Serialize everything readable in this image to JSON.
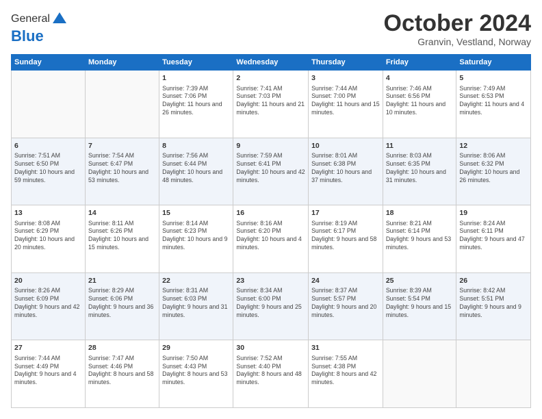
{
  "logo": {
    "general": "General",
    "blue": "Blue"
  },
  "header": {
    "month": "October 2024",
    "location": "Granvin, Vestland, Norway"
  },
  "weekdays": [
    "Sunday",
    "Monday",
    "Tuesday",
    "Wednesday",
    "Thursday",
    "Friday",
    "Saturday"
  ],
  "weeks": [
    [
      {
        "day": "",
        "info": ""
      },
      {
        "day": "",
        "info": ""
      },
      {
        "day": "1",
        "info": "Sunrise: 7:39 AM\nSunset: 7:06 PM\nDaylight: 11 hours and 26 minutes."
      },
      {
        "day": "2",
        "info": "Sunrise: 7:41 AM\nSunset: 7:03 PM\nDaylight: 11 hours and 21 minutes."
      },
      {
        "day": "3",
        "info": "Sunrise: 7:44 AM\nSunset: 7:00 PM\nDaylight: 11 hours and 15 minutes."
      },
      {
        "day": "4",
        "info": "Sunrise: 7:46 AM\nSunset: 6:56 PM\nDaylight: 11 hours and 10 minutes."
      },
      {
        "day": "5",
        "info": "Sunrise: 7:49 AM\nSunset: 6:53 PM\nDaylight: 11 hours and 4 minutes."
      }
    ],
    [
      {
        "day": "6",
        "info": "Sunrise: 7:51 AM\nSunset: 6:50 PM\nDaylight: 10 hours and 59 minutes."
      },
      {
        "day": "7",
        "info": "Sunrise: 7:54 AM\nSunset: 6:47 PM\nDaylight: 10 hours and 53 minutes."
      },
      {
        "day": "8",
        "info": "Sunrise: 7:56 AM\nSunset: 6:44 PM\nDaylight: 10 hours and 48 minutes."
      },
      {
        "day": "9",
        "info": "Sunrise: 7:59 AM\nSunset: 6:41 PM\nDaylight: 10 hours and 42 minutes."
      },
      {
        "day": "10",
        "info": "Sunrise: 8:01 AM\nSunset: 6:38 PM\nDaylight: 10 hours and 37 minutes."
      },
      {
        "day": "11",
        "info": "Sunrise: 8:03 AM\nSunset: 6:35 PM\nDaylight: 10 hours and 31 minutes."
      },
      {
        "day": "12",
        "info": "Sunrise: 8:06 AM\nSunset: 6:32 PM\nDaylight: 10 hours and 26 minutes."
      }
    ],
    [
      {
        "day": "13",
        "info": "Sunrise: 8:08 AM\nSunset: 6:29 PM\nDaylight: 10 hours and 20 minutes."
      },
      {
        "day": "14",
        "info": "Sunrise: 8:11 AM\nSunset: 6:26 PM\nDaylight: 10 hours and 15 minutes."
      },
      {
        "day": "15",
        "info": "Sunrise: 8:14 AM\nSunset: 6:23 PM\nDaylight: 10 hours and 9 minutes."
      },
      {
        "day": "16",
        "info": "Sunrise: 8:16 AM\nSunset: 6:20 PM\nDaylight: 10 hours and 4 minutes."
      },
      {
        "day": "17",
        "info": "Sunrise: 8:19 AM\nSunset: 6:17 PM\nDaylight: 9 hours and 58 minutes."
      },
      {
        "day": "18",
        "info": "Sunrise: 8:21 AM\nSunset: 6:14 PM\nDaylight: 9 hours and 53 minutes."
      },
      {
        "day": "19",
        "info": "Sunrise: 8:24 AM\nSunset: 6:11 PM\nDaylight: 9 hours and 47 minutes."
      }
    ],
    [
      {
        "day": "20",
        "info": "Sunrise: 8:26 AM\nSunset: 6:09 PM\nDaylight: 9 hours and 42 minutes."
      },
      {
        "day": "21",
        "info": "Sunrise: 8:29 AM\nSunset: 6:06 PM\nDaylight: 9 hours and 36 minutes."
      },
      {
        "day": "22",
        "info": "Sunrise: 8:31 AM\nSunset: 6:03 PM\nDaylight: 9 hours and 31 minutes."
      },
      {
        "day": "23",
        "info": "Sunrise: 8:34 AM\nSunset: 6:00 PM\nDaylight: 9 hours and 25 minutes."
      },
      {
        "day": "24",
        "info": "Sunrise: 8:37 AM\nSunset: 5:57 PM\nDaylight: 9 hours and 20 minutes."
      },
      {
        "day": "25",
        "info": "Sunrise: 8:39 AM\nSunset: 5:54 PM\nDaylight: 9 hours and 15 minutes."
      },
      {
        "day": "26",
        "info": "Sunrise: 8:42 AM\nSunset: 5:51 PM\nDaylight: 9 hours and 9 minutes."
      }
    ],
    [
      {
        "day": "27",
        "info": "Sunrise: 7:44 AM\nSunset: 4:49 PM\nDaylight: 9 hours and 4 minutes."
      },
      {
        "day": "28",
        "info": "Sunrise: 7:47 AM\nSunset: 4:46 PM\nDaylight: 8 hours and 58 minutes."
      },
      {
        "day": "29",
        "info": "Sunrise: 7:50 AM\nSunset: 4:43 PM\nDaylight: 8 hours and 53 minutes."
      },
      {
        "day": "30",
        "info": "Sunrise: 7:52 AM\nSunset: 4:40 PM\nDaylight: 8 hours and 48 minutes."
      },
      {
        "day": "31",
        "info": "Sunrise: 7:55 AM\nSunset: 4:38 PM\nDaylight: 8 hours and 42 minutes."
      },
      {
        "day": "",
        "info": ""
      },
      {
        "day": "",
        "info": ""
      }
    ]
  ]
}
